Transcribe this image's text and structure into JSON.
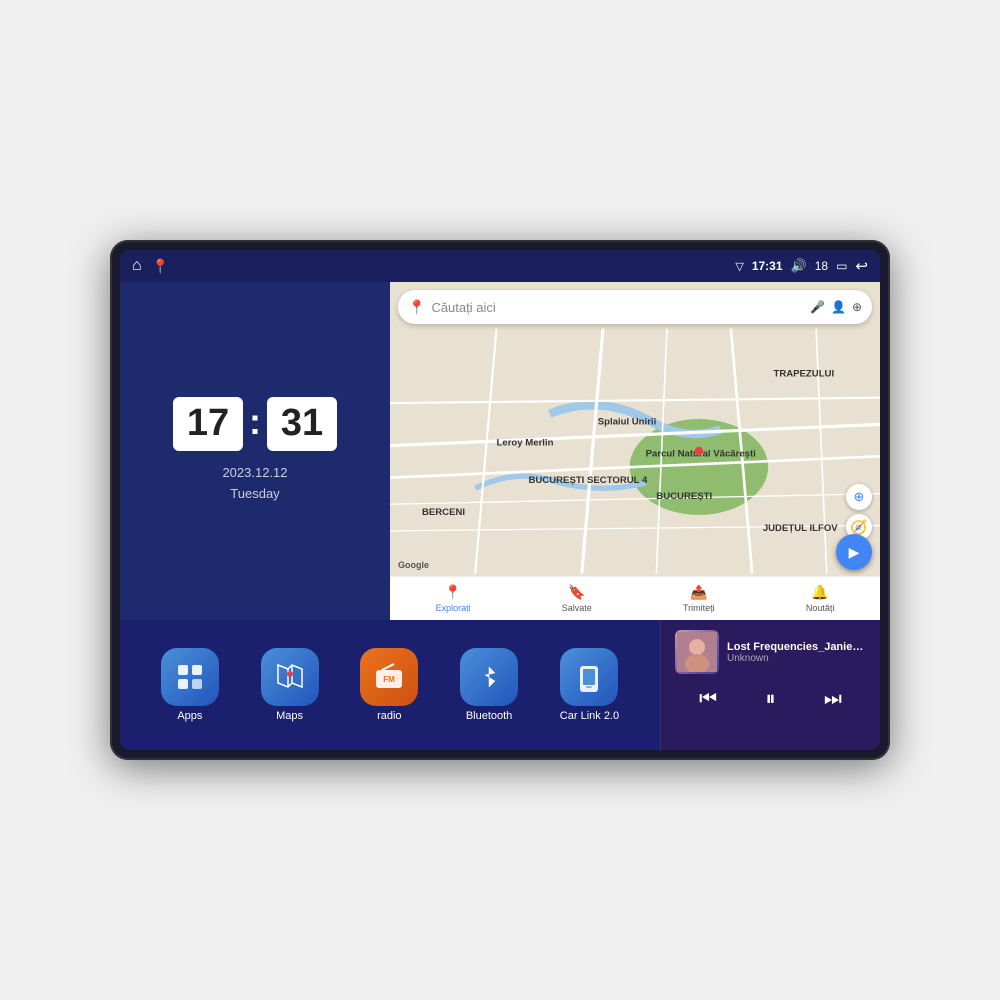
{
  "device": {
    "screen_bg": "#1a1f5e"
  },
  "status_bar": {
    "signal_icon": "▽",
    "time": "17:31",
    "volume_icon": "🔊",
    "battery_level": "18",
    "battery_icon": "🔋",
    "back_icon": "↩"
  },
  "nav_icons": {
    "home": "⌂",
    "maps_pin": "📍"
  },
  "clock": {
    "hours": "17",
    "minutes": "31",
    "date": "2023.12.12",
    "day": "Tuesday"
  },
  "map": {
    "search_placeholder": "Căutați aici",
    "nav_items": [
      {
        "label": "Explorați",
        "icon": "📍",
        "active": true
      },
      {
        "label": "Salvate",
        "icon": "🔖",
        "active": false
      },
      {
        "label": "Trimiteți",
        "icon": "📤",
        "active": false
      },
      {
        "label": "Noutăți",
        "icon": "🔔",
        "active": false
      }
    ],
    "labels": [
      "BERCENI",
      "BUCUREȘTI",
      "JUDEȚUL ILFOV",
      "TRAPEZULUI",
      "Parcul Natural Văcărești",
      "Leroy Merlin",
      "BUCUREȘTI SECTORUL 4",
      "Splaiurl Unirii"
    ]
  },
  "apps": [
    {
      "id": "apps",
      "label": "Apps",
      "icon": "⊞",
      "color_class": "icon-apps"
    },
    {
      "id": "maps",
      "label": "Maps",
      "icon": "🗺",
      "color_class": "icon-maps"
    },
    {
      "id": "radio",
      "label": "radio",
      "icon": "📻",
      "color_class": "icon-radio"
    },
    {
      "id": "bluetooth",
      "label": "Bluetooth",
      "icon": "⬡",
      "color_class": "icon-bluetooth"
    },
    {
      "id": "carlink",
      "label": "Car Link 2.0",
      "icon": "📱",
      "color_class": "icon-carlink"
    }
  ],
  "music": {
    "title": "Lost Frequencies_Janieck Devy-...",
    "artist": "Unknown",
    "prev_icon": "⏮",
    "play_icon": "⏸",
    "next_icon": "⏭"
  }
}
